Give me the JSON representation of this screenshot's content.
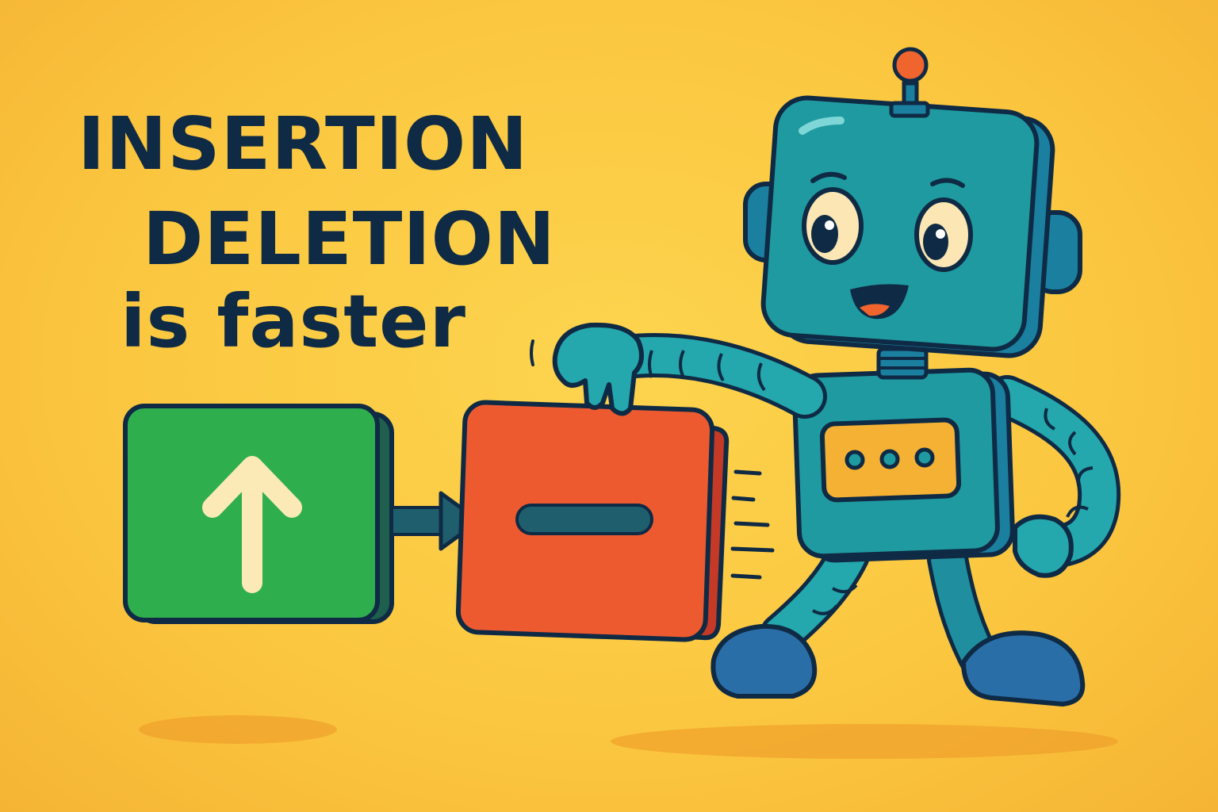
{
  "headline": {
    "line1": "INSERTION",
    "line2": "DELETION",
    "line3": "is faster"
  },
  "colors": {
    "background": "#fbc63f",
    "text": "#0f2a44",
    "insert_box": "#2fae4e",
    "delete_box": "#ee5a2f",
    "robot": "#1f9aa0",
    "robot_panel": "#f5b134",
    "outline": "#0f2a44"
  },
  "icons": {
    "insert": "up-arrow-icon",
    "delete": "minus-icon",
    "flow": "right-arrow-icon"
  }
}
